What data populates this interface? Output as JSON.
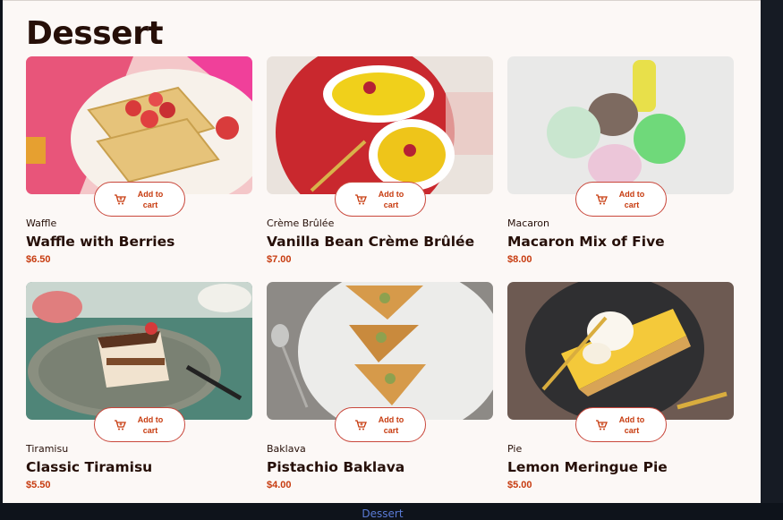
{
  "page": {
    "title": "Dessert",
    "caption": "Dessert"
  },
  "cart_button_label": "Add to cart",
  "items": [
    {
      "category": "Waffle",
      "name": "Waffle with Berries",
      "price": "$6.50"
    },
    {
      "category": "Crème Brûlée",
      "name": "Vanilla Bean Crème Brûlée",
      "price": "$7.00"
    },
    {
      "category": "Macaron",
      "name": "Macaron Mix of Five",
      "price": "$8.00"
    },
    {
      "category": "Tiramisu",
      "name": "Classic Tiramisu",
      "price": "$5.50"
    },
    {
      "category": "Baklava",
      "name": "Pistachio Baklava",
      "price": "$4.00"
    },
    {
      "category": "Pie",
      "name": "Lemon Meringue Pie",
      "price": "$5.00"
    }
  ],
  "colors": {
    "accent": "#c73b0f",
    "text": "#260f08",
    "page_bg": "#fcf8f6"
  }
}
